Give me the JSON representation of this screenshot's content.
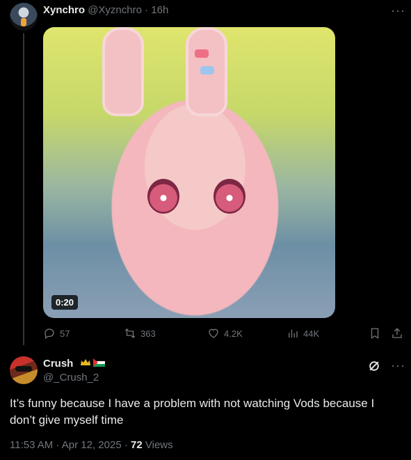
{
  "tweet": {
    "author": {
      "name": "Xynchro",
      "handle": "@Xyznchro",
      "sep": "·",
      "time": "16h"
    },
    "more_label": "···",
    "media": {
      "duration": "0:20"
    },
    "stats": {
      "replies": "57",
      "reposts": "363",
      "likes": "4.2K",
      "views": "44K"
    }
  },
  "reply": {
    "author": {
      "name": "Crush",
      "handle": "@_Crush_2"
    },
    "more_label": "···",
    "text": "It’s funny because I have a problem with not watching Vods because I don’t give myself time",
    "meta": {
      "time": "11:53 AM",
      "sep1": "·",
      "date": "Apr 12, 2025",
      "sep2": "·",
      "views_count": "72",
      "views_label": "Views"
    }
  }
}
